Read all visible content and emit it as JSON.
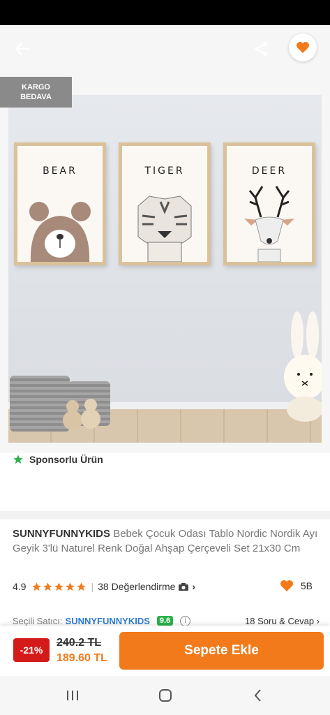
{
  "header": {
    "back_icon": "arrow-left-icon",
    "share_icon": "share-icon",
    "favorite_icon": "heart-icon",
    "accent_color": "#f27a1a"
  },
  "product": {
    "cargo_badge": "KARGO\nBEDAVA",
    "frames": [
      "BEAR",
      "TIGER",
      "DEER"
    ],
    "sponsor_label": "Sponsorlu Ürün",
    "brand": "SUNNYFUNNYKIDS",
    "title": "Bebek Çocuk Odası Tablo Nordic Nordik Ayı Geyik 3'lü Naturel Renk Doğal Ahşap Çerçeveli Set 21x30 Cm"
  },
  "rating": {
    "score": "4.9",
    "star_count": 5,
    "reviews": "38 Değerlendirme",
    "camera_icon": "camera-icon",
    "chevron": "›",
    "likes": "5B",
    "star_color": "#f27a1a"
  },
  "seller": {
    "label": "Seçili Satıcı:",
    "name": "SUNNYFUNNYKIDS",
    "score": "9.6",
    "score_color": "#2bb24c",
    "qa": "18 Soru & Cevap ›"
  },
  "cart": {
    "discount": "-21%",
    "old_price": "240.2 TL",
    "new_price": "189.60 TL",
    "button": "Sepete Ekle",
    "discount_color": "#d51a1a"
  },
  "navbar": {
    "recent_icon": "recent-apps-icon",
    "home_icon": "home-icon",
    "back_icon": "back-icon"
  }
}
